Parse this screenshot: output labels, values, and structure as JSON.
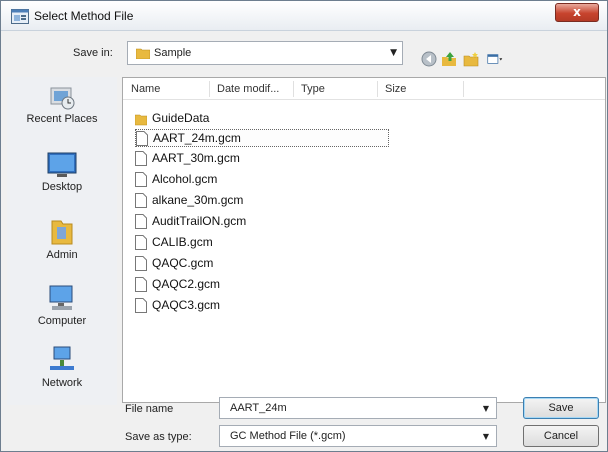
{
  "window": {
    "title": "Select Method File"
  },
  "title_bar": {
    "close_glyph": "x"
  },
  "save_in": {
    "label": "Save in:",
    "value": "Sample"
  },
  "places": [
    {
      "label": "Recent Places",
      "icon": "recent-places-icon"
    },
    {
      "label": "Desktop",
      "icon": "desktop-icon"
    },
    {
      "label": "Admin",
      "icon": "admin-folder-icon"
    },
    {
      "label": "Computer",
      "icon": "computer-icon"
    },
    {
      "label": "Network",
      "icon": "network-icon"
    }
  ],
  "columns": [
    "Name",
    "Date modif...",
    "Type",
    "Size"
  ],
  "files": [
    {
      "name": "GuideData",
      "kind": "folder"
    },
    {
      "name": "AART_24m.gcm",
      "kind": "file",
      "selected": true
    },
    {
      "name": "AART_30m.gcm",
      "kind": "file"
    },
    {
      "name": "Alcohol.gcm",
      "kind": "file"
    },
    {
      "name": "alkane_30m.gcm",
      "kind": "file"
    },
    {
      "name": "AuditTrailON.gcm",
      "kind": "file"
    },
    {
      "name": "CALIB.gcm",
      "kind": "file"
    },
    {
      "name": "QAQC.gcm",
      "kind": "file"
    },
    {
      "name": "QAQC2.gcm",
      "kind": "file"
    },
    {
      "name": "QAQC3.gcm",
      "kind": "file"
    }
  ],
  "filename": {
    "label": "File name",
    "value": "AART_24m"
  },
  "save_as_type": {
    "label": "Save as type:",
    "value": "GC Method File (*.gcm)"
  },
  "buttons": {
    "save": "Save",
    "cancel": "Cancel"
  },
  "colors": {
    "folder": "#e8b93f",
    "close": "#c7442e",
    "default_button": "#3c7fb1"
  }
}
